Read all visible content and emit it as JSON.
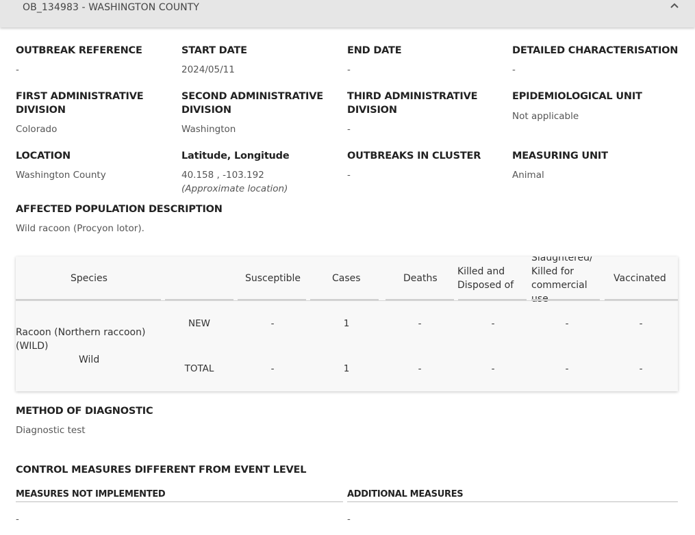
{
  "header": {
    "title": "OB_134983 - WASHINGTON COUNTY",
    "toggle_icon": "chevron-up-icon"
  },
  "fields": {
    "outbreak_reference": {
      "label": "OUTBREAK REFERENCE",
      "value": "-"
    },
    "start_date": {
      "label": "START DATE",
      "value": "2024/05/11"
    },
    "end_date": {
      "label": "END DATE",
      "value": "-"
    },
    "detailed_characterisation": {
      "label": "DETAILED CHARACTERISATION",
      "value": "-"
    },
    "first_admin_division": {
      "label_line1": "FIRST ADMINISTRATIVE",
      "label_line2": "DIVISION",
      "value": "Colorado"
    },
    "second_admin_division": {
      "label_line1": "SECOND ADMINISTRATIVE",
      "label_line2": "DIVISION",
      "value": "Washington"
    },
    "third_admin_division": {
      "label_line1": "THIRD ADMINISTRATIVE",
      "label_line2": "DIVISION",
      "value": "-"
    },
    "epidemiological_unit": {
      "label": "EPIDEMIOLOGICAL UNIT",
      "value": "Not applicable"
    },
    "location": {
      "label": "LOCATION",
      "value": "Washington County"
    },
    "lat_long": {
      "label": "Latitude, Longitude",
      "value": "40.158 , -103.192",
      "note": "(Approximate location)"
    },
    "outbreaks_in_cluster": {
      "label": "OUTBREAKS IN CLUSTER",
      "value": "-"
    },
    "measuring_unit": {
      "label": "MEASURING UNIT",
      "value": "Animal"
    },
    "affected_population": {
      "label": "AFFECTED POPULATION DESCRIPTION",
      "value": "Wild racoon (Procyon lotor)."
    }
  },
  "table": {
    "headers": {
      "species": "Species",
      "susceptible": "Susceptible",
      "cases": "Cases",
      "deaths": "Deaths",
      "killed_line1": "Killed and",
      "killed_line2": "Disposed of",
      "slaughtered_line1": "Slaughtered/",
      "slaughtered_line2": "Killed for",
      "slaughtered_line3": "commercial",
      "slaughtered_line4": "use",
      "vaccinated": "Vaccinated"
    },
    "species_name_line1": "Racoon (Northern raccoon)",
    "species_name_line2": "(WILD)",
    "species_type": "Wild",
    "rows": [
      {
        "label": "NEW",
        "susceptible": "-",
        "cases": "1",
        "deaths": "-",
        "killed": "-",
        "slaughtered": "-",
        "vaccinated": "-"
      },
      {
        "label": "TOTAL",
        "susceptible": "-",
        "cases": "1",
        "deaths": "-",
        "killed": "-",
        "slaughtered": "-",
        "vaccinated": "-"
      }
    ]
  },
  "diagnostic": {
    "label": "METHOD OF DIAGNOSTIC",
    "value": "Diagnostic test"
  },
  "control": {
    "title": "CONTROL MEASURES DIFFERENT FROM EVENT LEVEL",
    "not_implemented_label": "MEASURES NOT IMPLEMENTED",
    "not_implemented_value": "-",
    "additional_label": "ADDITIONAL MEASURES",
    "additional_value": "-"
  }
}
